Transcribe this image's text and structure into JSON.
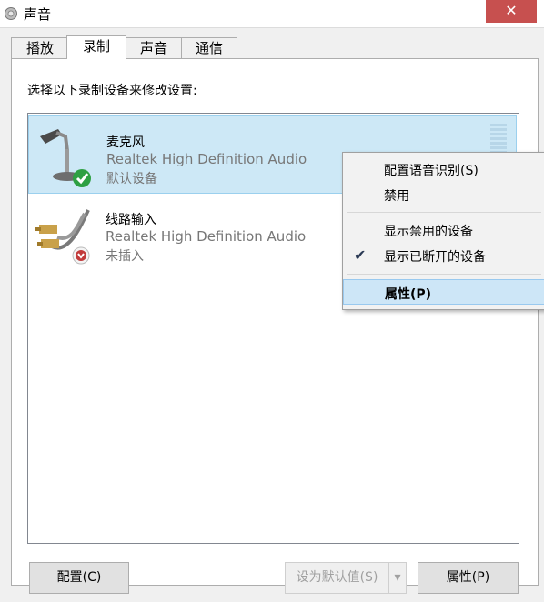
{
  "window": {
    "title": "声音",
    "close_symbol": "✕"
  },
  "tabs": [
    {
      "label": "播放",
      "active": false
    },
    {
      "label": "录制",
      "active": true
    },
    {
      "label": "声音",
      "active": false
    },
    {
      "label": "通信",
      "active": false
    }
  ],
  "instruction": "选择以下录制设备来修改设置:",
  "devices": [
    {
      "name": "麦克风",
      "driver": "Realtek High Definition Audio",
      "status": "默认设备",
      "selected": true,
      "icon": "microphone-icon",
      "badge": "green-check-icon"
    },
    {
      "name": "线路输入",
      "driver": "Realtek High Definition Audio",
      "status": "未插入",
      "selected": false,
      "icon": "rca-cable-icon",
      "badge": "red-down-arrow-icon"
    }
  ],
  "context_menu": {
    "items": [
      {
        "label": "配置语音识别(S)",
        "checked": false
      },
      {
        "label": "禁用",
        "checked": false
      },
      {
        "label": "显示禁用的设备",
        "checked": false
      },
      {
        "label": "显示已断开的设备",
        "checked": true,
        "check_symbol": "✔"
      },
      {
        "label": "属性(P)",
        "checked": false,
        "highlighted": true
      }
    ]
  },
  "buttons": {
    "configure": "配置(C)",
    "set_default": "设为默认值(S)",
    "set_default_arrow": "▾",
    "properties": "属性(P)"
  },
  "colors": {
    "selection": "#cde8f6",
    "close": "#c7504f",
    "accent_check": "#2ea043"
  }
}
